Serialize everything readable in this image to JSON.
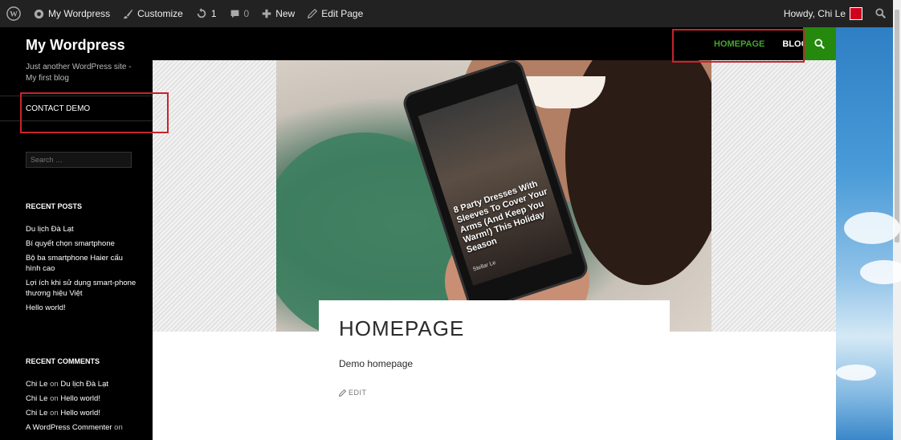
{
  "admin_bar": {
    "site_name": "My Wordpress",
    "customize": "Customize",
    "updates_count": "1",
    "comments_count": "0",
    "new_label": "New",
    "edit_page": "Edit Page",
    "howdy": "Howdy, Chi Le"
  },
  "header": {
    "site_title": "My Wordpress",
    "nav": [
      {
        "label": "HOMEPAGE",
        "active": true
      },
      {
        "label": "BLOGS",
        "active": false
      }
    ]
  },
  "sidebar": {
    "description": "Just another WordPress site - My first blog",
    "menu_item": "CONTACT DEMO",
    "search_placeholder": "Search …",
    "recent_posts_title": "RECENT POSTS",
    "recent_posts": [
      "Du lịch Đà Lạt",
      "Bí quyết chọn smartphone",
      "Bộ ba smartphone Haier cấu hình cao",
      "Lợi ích khi sử dụng smart-phone thương hiệu Việt",
      "Hello world!"
    ],
    "recent_comments_title": "RECENT COMMENTS",
    "recent_comments": [
      {
        "author": "Chi Le",
        "on": "on",
        "post": "Du lịch Đà Lạt"
      },
      {
        "author": "Chi Le",
        "on": "on",
        "post": "Hello world!"
      },
      {
        "author": "Chi Le",
        "on": "on",
        "post": "Hello world!"
      },
      {
        "author": "A WordPress Commenter",
        "on": "on",
        "post": ""
      }
    ]
  },
  "featured": {
    "phone_caption": "8 Party Dresses With Sleeves To Cover Your Arms (And Keep You Warm!) This Holiday Season",
    "phone_author": "Stellar Le"
  },
  "article": {
    "title": "HOMEPAGE",
    "content": "Demo homepage",
    "edit": "EDIT"
  },
  "colors": {
    "accent_green": "#24890d",
    "active_nav": "#41a62a",
    "annotation_red": "#c8232c"
  }
}
